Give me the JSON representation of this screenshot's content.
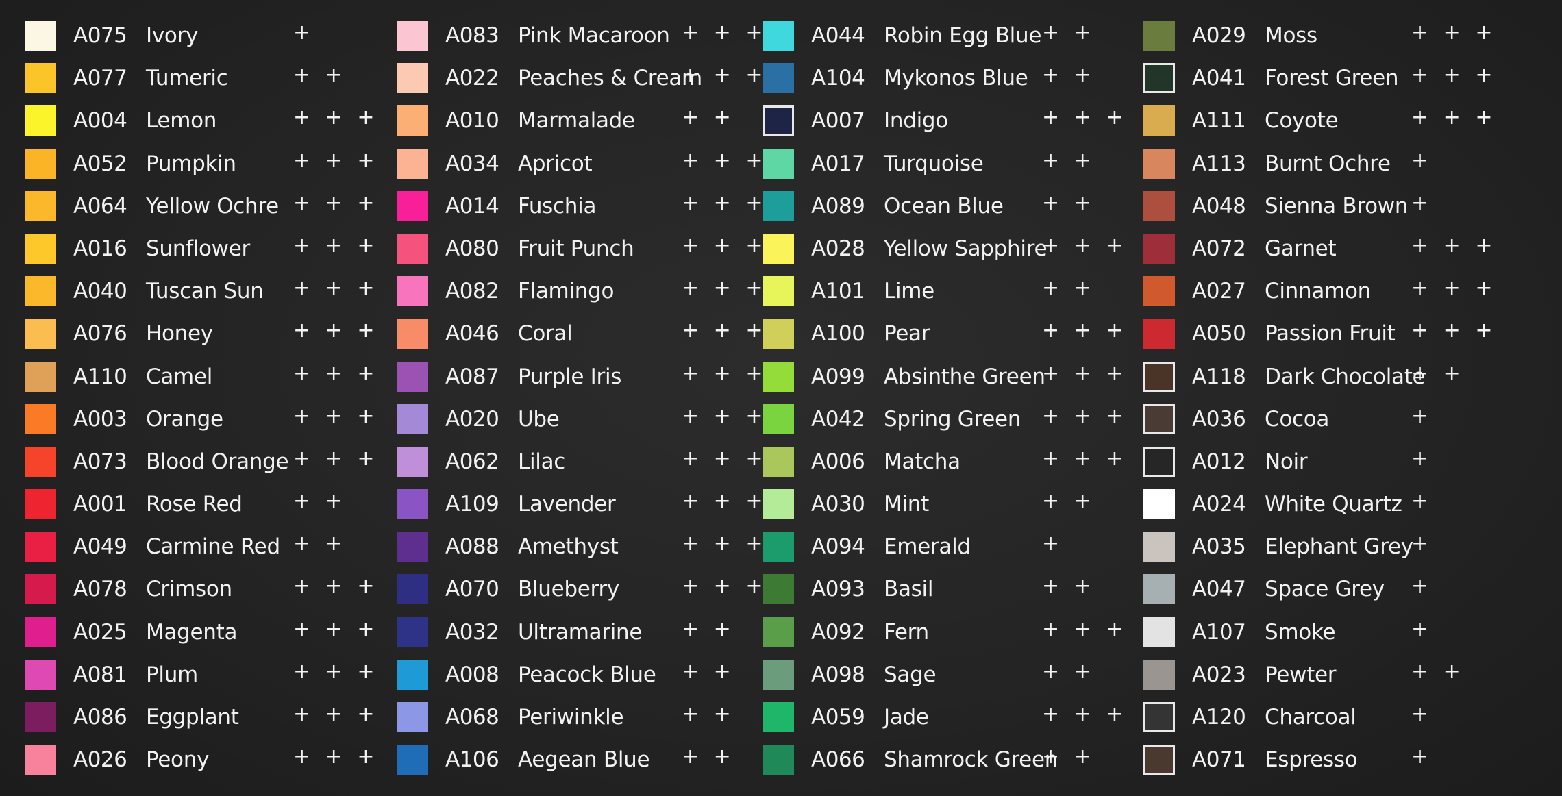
{
  "columns": [
    {
      "items": [
        {
          "code": "A075",
          "name": "Ivory",
          "color": "#fbf7e4",
          "rating": "+"
        },
        {
          "code": "A077",
          "name": "Tumeric",
          "color": "#fbc52a",
          "rating": "+ +"
        },
        {
          "code": "A004",
          "name": "Lemon",
          "color": "#fbf42a",
          "rating": "+ + +"
        },
        {
          "code": "A052",
          "name": "Pumpkin",
          "color": "#fbb426",
          "rating": "+ + +"
        },
        {
          "code": "A064",
          "name": "Yellow Ochre",
          "color": "#fbb82a",
          "rating": "+ + +"
        },
        {
          "code": "A016",
          "name": "Sunflower",
          "color": "#fcc82a",
          "rating": "+ + +"
        },
        {
          "code": "A040",
          "name": "Tuscan Sun",
          "color": "#fbb82a",
          "rating": "+ + +"
        },
        {
          "code": "A076",
          "name": "Honey",
          "color": "#fbbc50",
          "rating": "+ + +"
        },
        {
          "code": "A110",
          "name": "Camel",
          "color": "#dfa057",
          "rating": "+ + +"
        },
        {
          "code": "A003",
          "name": "Orange",
          "color": "#fb7a26",
          "rating": "+ + +"
        },
        {
          "code": "A073",
          "name": "Blood Orange",
          "color": "#f5442a",
          "rating": "+ + +"
        },
        {
          "code": "A001",
          "name": "Rose Red",
          "color": "#ee2431",
          "rating": "+ +"
        },
        {
          "code": "A049",
          "name": "Carmine Red",
          "color": "#ea1f44",
          "rating": "+ +"
        },
        {
          "code": "A078",
          "name": "Crimson",
          "color": "#d61a4c",
          "rating": "+ + +"
        },
        {
          "code": "A025",
          "name": "Magenta",
          "color": "#de1f8c",
          "rating": "+ + +"
        },
        {
          "code": "A081",
          "name": "Plum",
          "color": "#df4ab2",
          "rating": "+ + +"
        },
        {
          "code": "A086",
          "name": "Eggplant",
          "color": "#7c1d60",
          "rating": "+ + +"
        },
        {
          "code": "A026",
          "name": "Peony",
          "color": "#f8829c",
          "rating": "+ + +"
        }
      ]
    },
    {
      "items": [
        {
          "code": "A083",
          "name": "Pink Macaroon",
          "color": "#fbc6d2",
          "rating": "+ + +"
        },
        {
          "code": "A022",
          "name": "Peaches & Cream",
          "color": "#fccab2",
          "rating": "+ + +"
        },
        {
          "code": "A010",
          "name": "Marmalade",
          "color": "#fbaf74",
          "rating": "+ +"
        },
        {
          "code": "A034",
          "name": "Apricot",
          "color": "#fcb394",
          "rating": "+ + +"
        },
        {
          "code": "A014",
          "name": "Fuschia",
          "color": "#f81f98",
          "rating": "+ + + +"
        },
        {
          "code": "A080",
          "name": "Fruit Punch",
          "color": "#f5527e",
          "rating": "+ + +"
        },
        {
          "code": "A082",
          "name": "Flamingo",
          "color": "#f874bc",
          "rating": "+ + +"
        },
        {
          "code": "A046",
          "name": "Coral",
          "color": "#f98c68",
          "rating": "+ + +"
        },
        {
          "code": "A087",
          "name": "Purple Iris",
          "color": "#9a52b3",
          "rating": "+ + +"
        },
        {
          "code": "A020",
          "name": "Ube",
          "color": "#a48ad6",
          "rating": "+ + +"
        },
        {
          "code": "A062",
          "name": "Lilac",
          "color": "#bf8fd9",
          "rating": "+ + +"
        },
        {
          "code": "A109",
          "name": "Lavender",
          "color": "#8a54c4",
          "rating": "+ + +"
        },
        {
          "code": "A088",
          "name": "Amethyst",
          "color": "#5e2f8f",
          "rating": "+ + +"
        },
        {
          "code": "A070",
          "name": "Blueberry",
          "color": "#2e2f82",
          "rating": "+ + +"
        },
        {
          "code": "A032",
          "name": "Ultramarine",
          "color": "#2e3387",
          "rating": "+ +"
        },
        {
          "code": "A008",
          "name": "Peacock Blue",
          "color": "#1e9ad6",
          "rating": "+ +"
        },
        {
          "code": "A068",
          "name": "Periwinkle",
          "color": "#8c97e6",
          "rating": "+ +"
        },
        {
          "code": "A106",
          "name": "Aegean Blue",
          "color": "#1e6db6",
          "rating": "+ +"
        }
      ]
    },
    {
      "items": [
        {
          "code": "A044",
          "name": "Robin Egg Blue",
          "color": "#3ed8dd",
          "rating": "+ +"
        },
        {
          "code": "A104",
          "name": "Mykonos Blue",
          "color": "#2a70a4",
          "rating": "+ +"
        },
        {
          "code": "A007",
          "name": "Indigo",
          "color": "#1e2445",
          "rating": "+ + +",
          "outlined": true
        },
        {
          "code": "A017",
          "name": "Turquoise",
          "color": "#5ed7a4",
          "rating": "+ +"
        },
        {
          "code": "A089",
          "name": "Ocean Blue",
          "color": "#1e9e9a",
          "rating": "+ +"
        },
        {
          "code": "A028",
          "name": "Yellow Sapphire",
          "color": "#fbf35a",
          "rating": "+ + +"
        },
        {
          "code": "A101",
          "name": "Lime",
          "color": "#e8f55a",
          "rating": "+ +"
        },
        {
          "code": "A100",
          "name": "Pear",
          "color": "#cfcf5a",
          "rating": "+ + +"
        },
        {
          "code": "A099",
          "name": "Absinthe Green",
          "color": "#93dc3a",
          "rating": "+ + +"
        },
        {
          "code": "A042",
          "name": "Spring Green",
          "color": "#79d43f",
          "rating": "+ + +"
        },
        {
          "code": "A006",
          "name": "Matcha",
          "color": "#a9c75a",
          "rating": "+ + +"
        },
        {
          "code": "A030",
          "name": "Mint",
          "color": "#b3eb98",
          "rating": "+ +"
        },
        {
          "code": "A094",
          "name": "Emerald",
          "color": "#1c9c6c",
          "rating": "+"
        },
        {
          "code": "A093",
          "name": "Basil",
          "color": "#3d7a33",
          "rating": "+ +"
        },
        {
          "code": "A092",
          "name": "Fern",
          "color": "#5a9e4a",
          "rating": "+ + +"
        },
        {
          "code": "A098",
          "name": "Sage",
          "color": "#6b9c7c",
          "rating": "+ +"
        },
        {
          "code": "A059",
          "name": "Jade",
          "color": "#1fb66a",
          "rating": "+ + +"
        },
        {
          "code": "A066",
          "name": "Shamrock Green",
          "color": "#1f8a57",
          "rating": "+ +"
        }
      ]
    },
    {
      "items": [
        {
          "code": "A029",
          "name": "Moss",
          "color": "#6a7c3e",
          "rating": "+ + +"
        },
        {
          "code": "A041",
          "name": "Forest Green",
          "color": "#213528",
          "rating": "+ + +",
          "outlined": true
        },
        {
          "code": "A111",
          "name": "Coyote",
          "color": "#d9ac4f",
          "rating": "+ + +"
        },
        {
          "code": "A113",
          "name": "Burnt Ochre",
          "color": "#d8865d",
          "rating": "+"
        },
        {
          "code": "A048",
          "name": "Sienna Brown",
          "color": "#ad4f3f",
          "rating": "+"
        },
        {
          "code": "A072",
          "name": "Garnet",
          "color": "#9e2f3a",
          "rating": "+ + +"
        },
        {
          "code": "A027",
          "name": "Cinnamon",
          "color": "#d1592e",
          "rating": "+ + +"
        },
        {
          "code": "A050",
          "name": "Passion Fruit",
          "color": "#cc2a30",
          "rating": "+ + +"
        },
        {
          "code": "A118",
          "name": "Dark Chocolate",
          "color": "#4a3327",
          "rating": "+ +",
          "outlined": true
        },
        {
          "code": "A036",
          "name": "Cocoa",
          "color": "#4a3c34",
          "rating": "+",
          "outlined": true
        },
        {
          "code": "A012",
          "name": "Noir",
          "color": "#262626",
          "rating": "+",
          "outlined": true
        },
        {
          "code": "A024",
          "name": "White Quartz",
          "color": "#ffffff",
          "rating": "+"
        },
        {
          "code": "A035",
          "name": "Elephant Grey",
          "color": "#cbc3bd",
          "rating": "+"
        },
        {
          "code": "A047",
          "name": "Space Grey",
          "color": "#a6b0b2",
          "rating": "+"
        },
        {
          "code": "A107",
          "name": "Smoke",
          "color": "#e3e3e3",
          "rating": "+"
        },
        {
          "code": "A023",
          "name": "Pewter",
          "color": "#9b9592",
          "rating": "+ +"
        },
        {
          "code": "A120",
          "name": "Charcoal",
          "color": "#343434",
          "rating": "+",
          "outlined": true
        },
        {
          "code": "A071",
          "name": "Espresso",
          "color": "#4a392f",
          "rating": "+",
          "outlined": true
        }
      ]
    }
  ]
}
